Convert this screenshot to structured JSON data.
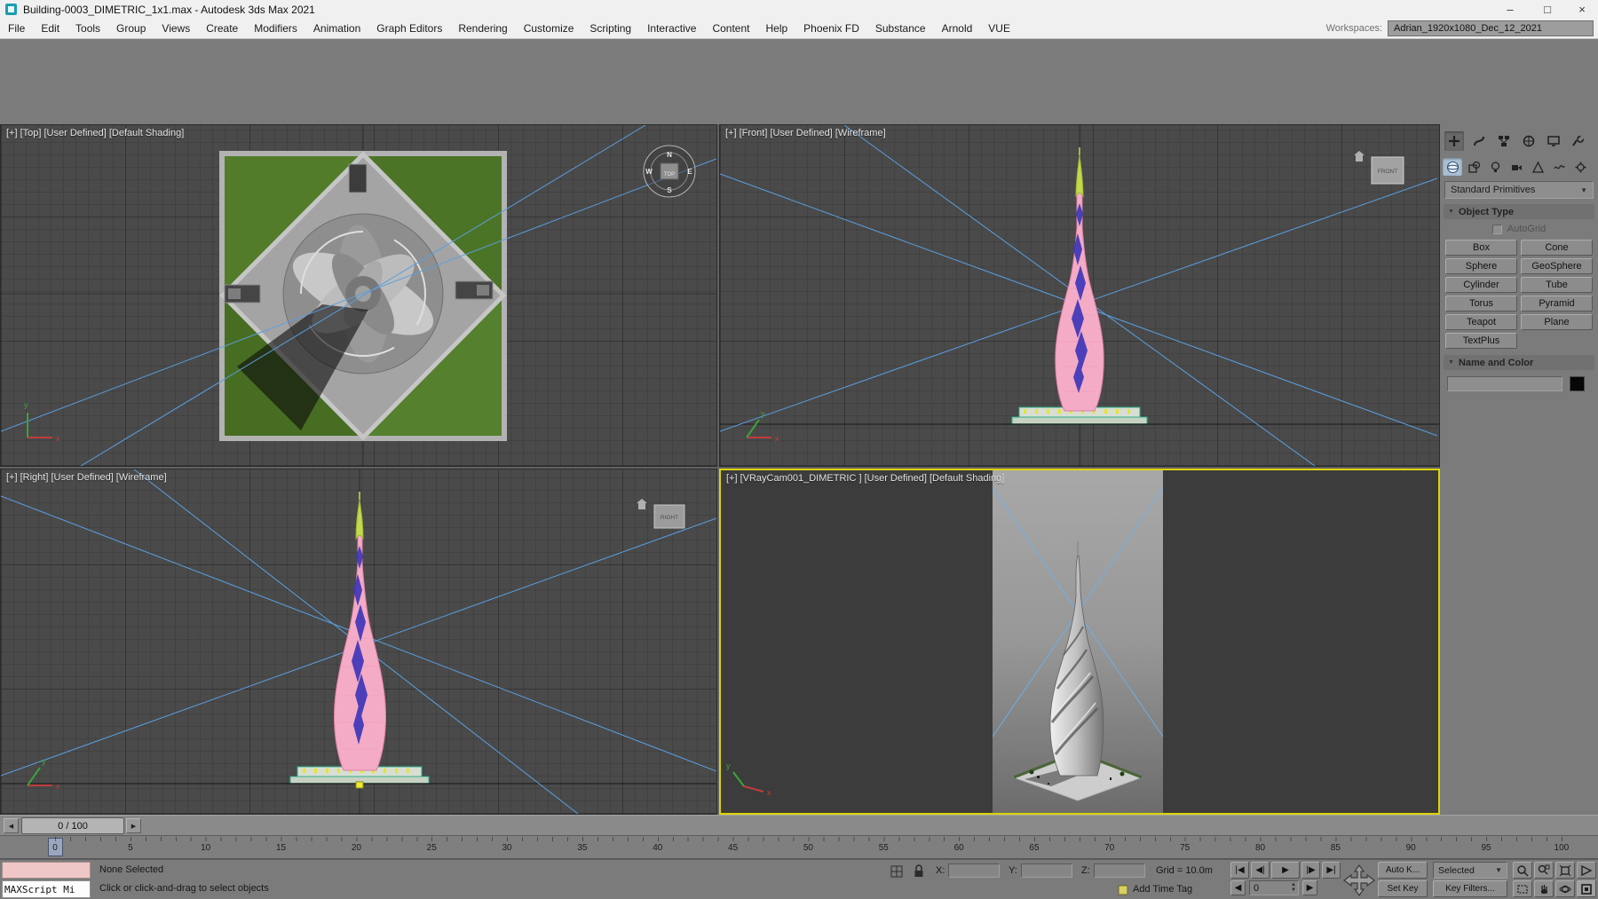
{
  "window": {
    "title": "Building-0003_DIMETRIC_1x1.max - Autodesk 3ds Max 2021"
  },
  "icons": {
    "minimize": "–",
    "maximize": "□",
    "close": "×",
    "dropdown_arrow": "▼",
    "rollout_open": "▼",
    "slider_left": "◀",
    "slider_right": "▶",
    "play_start": "|◀",
    "play_prev": "◀|",
    "play": "▶",
    "play_next": "|▶",
    "play_end": "▶|",
    "spin_up": "▲",
    "spin_down": "▼",
    "frame_back": "◀",
    "frame_fwd": "▶"
  },
  "menu": {
    "items": [
      "File",
      "Edit",
      "Tools",
      "Group",
      "Views",
      "Create",
      "Modifiers",
      "Animation",
      "Graph Editors",
      "Rendering",
      "Customize",
      "Scripting",
      "Interactive",
      "Content",
      "Help",
      "Phoenix FD",
      "Substance",
      "Arnold",
      "VUE"
    ],
    "workspaces_label": "Workspaces:",
    "workspace_value": "Adrian_1920x1080_Dec_12_2021"
  },
  "viewports": {
    "top": {
      "label": "[+] [Top] [User Defined] [Default Shading]"
    },
    "front": {
      "label": "[+] [Front] [User Defined] [Wireframe]",
      "cube": "FRONT"
    },
    "right": {
      "label": "[+] [Right] [User Defined] [Wireframe]",
      "cube": "RIGHT"
    },
    "camera": {
      "label": "[+] [VRayCam001_DIMETRIC ] [User Defined] [Default Shading]"
    },
    "compass": {
      "n": "N",
      "e": "E",
      "s": "S",
      "w": "W",
      "center": "TOP"
    },
    "axis": {
      "x": "x",
      "y": "y"
    }
  },
  "command_panel": {
    "category_dropdown": "Standard Primitives",
    "object_type_label": "Object Type",
    "autogrid_label": "AutoGrid",
    "buttons": [
      "Box",
      "Cone",
      "Sphere",
      "GeoSphere",
      "Cylinder",
      "Tube",
      "Torus",
      "Pyramid",
      "Teapot",
      "Plane",
      "TextPlus"
    ],
    "name_color_label": "Name and Color"
  },
  "timeline": {
    "slider_value": "0 / 100",
    "ticks": [
      "0",
      "5",
      "10",
      "15",
      "20",
      "25",
      "30",
      "35",
      "40",
      "45",
      "50",
      "55",
      "60",
      "65",
      "70",
      "75",
      "80",
      "85",
      "90",
      "95",
      "100"
    ]
  },
  "statusbar": {
    "maxscript_text": "MAXScript Mi",
    "status": "None Selected",
    "prompt": "Click or click-and-drag to select objects",
    "x_label": "X:",
    "y_label": "Y:",
    "z_label": "Z:",
    "grid_readout": "Grid = 10.0m",
    "add_time_tag": "Add Time Tag",
    "auto_key": "Auto K...",
    "set_key": "Set Key",
    "selected_filter": "Selected",
    "key_filters": "Key Filters...",
    "frame_value": "0"
  }
}
